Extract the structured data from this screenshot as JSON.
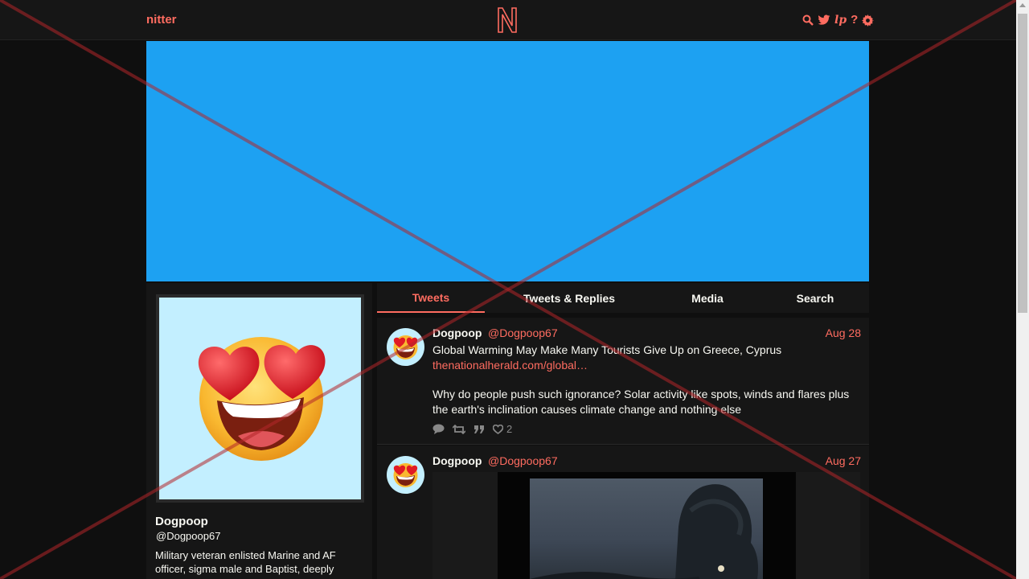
{
  "navbar": {
    "brand": "nitter",
    "logo_letter": "N",
    "icons": [
      "search-icon",
      "twitter-bird-icon",
      "liberapay-icon",
      "help-icon",
      "settings-gear-icon"
    ],
    "lp": "lp",
    "help": "?"
  },
  "colors": {
    "accent": "#ff6c60",
    "banner": "#1da1f2",
    "background": "#0f0f0f",
    "panel": "#161616",
    "avatar_bg": "#c3efff"
  },
  "profile": {
    "name": "Dogpoop",
    "handle": "@Dogpoop67",
    "bio": "Military veteran enlisted Marine and AF officer, sigma male and Baptist, deeply",
    "avatar_icon": "heart-eyes-emoji-icon"
  },
  "tabs": [
    {
      "label": "Tweets",
      "active": true
    },
    {
      "label": "Tweets & Replies",
      "active": false
    },
    {
      "label": "Media",
      "active": false
    },
    {
      "label": "Search",
      "active": false
    }
  ],
  "tweets": [
    {
      "name": "Dogpoop",
      "handle": "@Dogpoop67",
      "date": "Aug 28",
      "line1": "Global Warming May Make Many Tourists Give Up on Greece, Cyprus",
      "link": "thenationalherald.com/global…",
      "text": "Why do people push such ignorance? Solar activity like spots, winds and flares plus the earth's inclination causes climate change and nothing else",
      "likes": "2"
    },
    {
      "name": "Dogpoop",
      "handle": "@Dogpoop67",
      "date": "Aug 27"
    }
  ]
}
